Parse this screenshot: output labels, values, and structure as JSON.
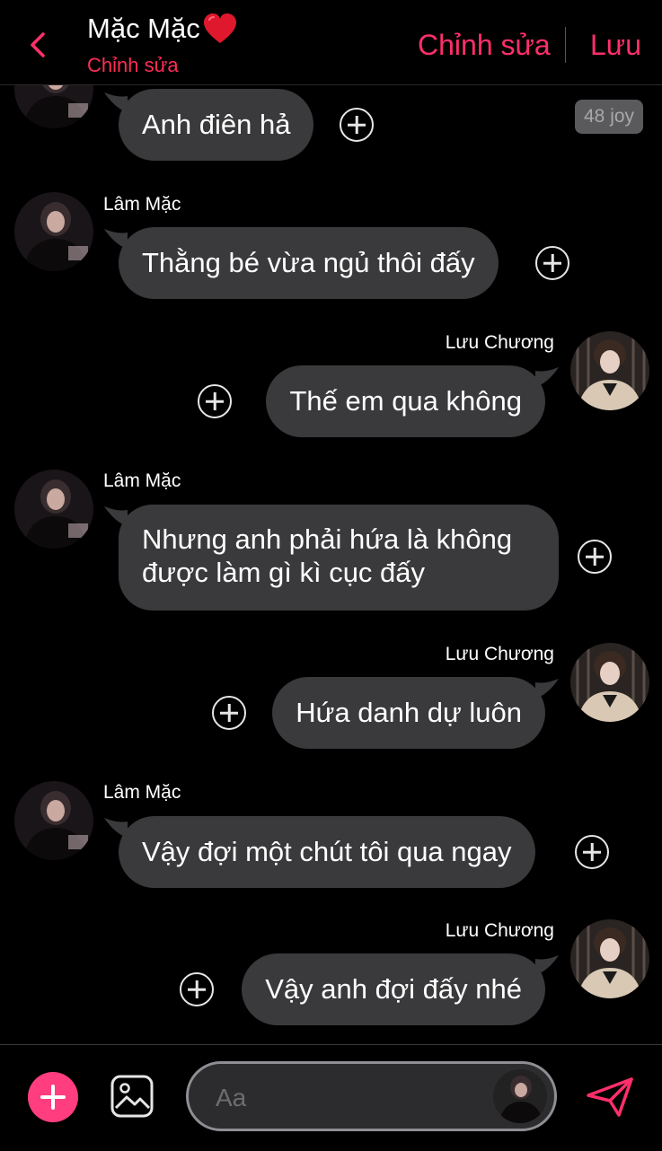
{
  "header": {
    "title": "Mặc Mặc",
    "title_icon": "red-heart-icon",
    "subtitle": "Chỉnh sửa",
    "edit_label": "Chỉnh sửa",
    "save_label": "Lưu",
    "back_icon": "chevron-left-icon"
  },
  "badge": "48 joy",
  "messages": [
    {
      "sender": "",
      "side": "left",
      "text": "Anh điên hả"
    },
    {
      "sender": "Lâm Mặc",
      "side": "left",
      "text": "Thằng bé vừa ngủ thôi đấy"
    },
    {
      "sender": "Lưu Chương",
      "side": "right",
      "text": "Thế em qua không"
    },
    {
      "sender": "Lâm Mặc",
      "side": "left",
      "text": "Nhưng anh phải hứa là không được làm gì kì cục đấy"
    },
    {
      "sender": "Lưu Chương",
      "side": "right",
      "text": "Hứa danh dự luôn"
    },
    {
      "sender": "Lâm Mặc",
      "side": "left",
      "text": "Vậy đợi một chút tôi qua ngay"
    },
    {
      "sender": "Lưu Chương",
      "side": "right",
      "text": "Vậy anh đợi đấy nhé"
    }
  ],
  "composer": {
    "placeholder": "Aa",
    "add_icon": "plus-icon",
    "image_icon": "image-icon",
    "send_icon": "send-icon"
  },
  "colors": {
    "accent": "#ff2f6a",
    "bubble": "#3a3a3c",
    "background": "#000000"
  }
}
